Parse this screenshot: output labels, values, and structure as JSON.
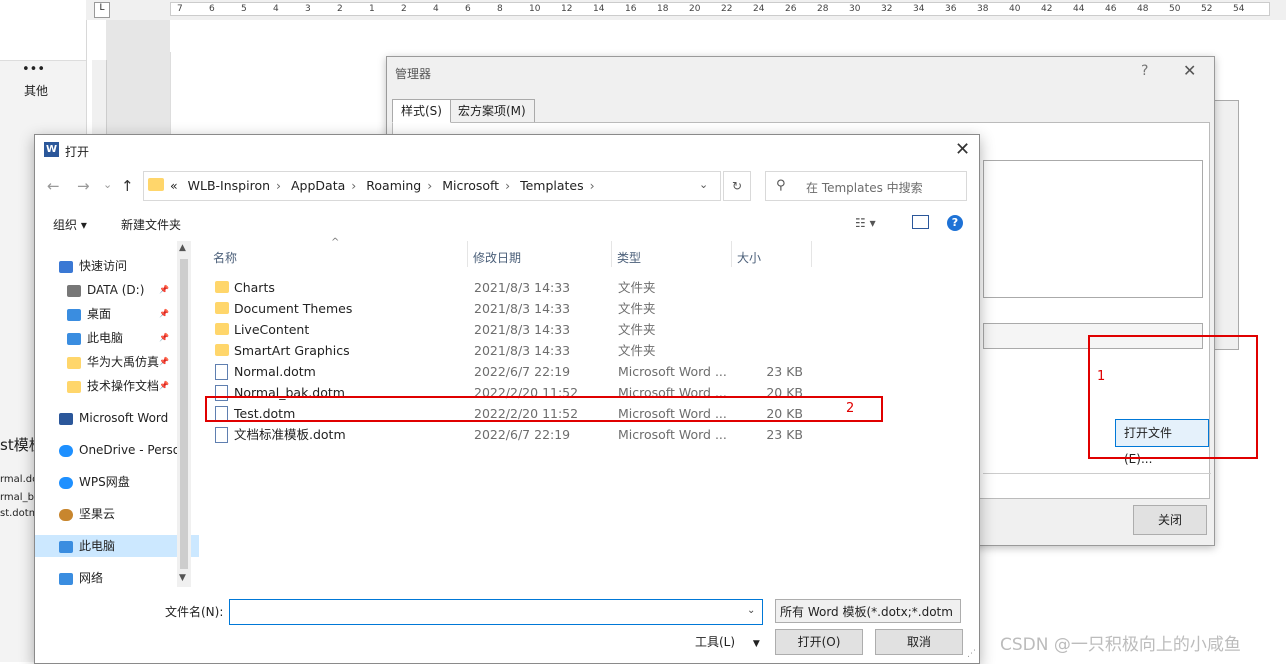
{
  "background": {
    "left_text": [
      "其他",
      "st模板",
      "rmal.do",
      "rmal_b",
      "st.dotm"
    ],
    "ruler_numbers": [
      "7",
      "6",
      "5",
      "4",
      "3",
      "2",
      "1",
      "2",
      "4",
      "6",
      "8",
      "10",
      "12",
      "14",
      "16",
      "18",
      "20",
      "22",
      "24",
      "26",
      "28",
      "30",
      "32",
      "34",
      "36",
      "38",
      "40",
      "42",
      "44",
      "46",
      "48",
      "50",
      "52",
      "54"
    ]
  },
  "manager": {
    "title": "管理器",
    "help": "?",
    "tabs": [
      {
        "label": "样式(S)"
      },
      {
        "label": "宏方案项(M)"
      }
    ],
    "open_file_button": "打开文件(E)...",
    "close_button": "关闭"
  },
  "open_dialog": {
    "title": "打开",
    "address": {
      "prefix": "«",
      "path": [
        "WLB-Inspiron",
        "AppData",
        "Roaming",
        "Microsoft",
        "Templates"
      ]
    },
    "search_placeholder": "在 Templates 中搜索",
    "toolbar": {
      "organize": "组织 ▾",
      "new_folder": "新建文件夹"
    },
    "nav": [
      {
        "label": "快速访问",
        "icon": "star-icon",
        "indent": 1
      },
      {
        "label": "DATA (D:)",
        "icon": "drive-icon",
        "indent": 2
      },
      {
        "label": "桌面",
        "icon": "desktop-icon",
        "indent": 2
      },
      {
        "label": "此电脑",
        "icon": "computer-icon",
        "indent": 2
      },
      {
        "label": "华为大禹仿真",
        "icon": "folder-icon",
        "indent": 2
      },
      {
        "label": "技术操作文档",
        "icon": "folder-icon",
        "indent": 2
      },
      {
        "label": "Microsoft Word",
        "icon": "word-icon",
        "indent": 1
      },
      {
        "label": "OneDrive - Perso",
        "icon": "cloud-icon",
        "indent": 1
      },
      {
        "label": "WPS网盘",
        "icon": "cloud-icon",
        "indent": 1
      },
      {
        "label": "坚果云",
        "icon": "nut-icon",
        "indent": 1
      },
      {
        "label": "此电脑",
        "icon": "computer-icon",
        "indent": 1
      },
      {
        "label": "网络",
        "icon": "network-icon",
        "indent": 1
      }
    ],
    "columns": {
      "name": "名称",
      "date": "修改日期",
      "type": "类型",
      "size": "大小"
    },
    "files": [
      {
        "name": "Charts",
        "date": "2021/8/3 14:33",
        "type": "文件夹",
        "size": "",
        "kind": "folder"
      },
      {
        "name": "Document Themes",
        "date": "2021/8/3 14:33",
        "type": "文件夹",
        "size": "",
        "kind": "folder"
      },
      {
        "name": "LiveContent",
        "date": "2021/8/3 14:33",
        "type": "文件夹",
        "size": "",
        "kind": "folder"
      },
      {
        "name": "SmartArt Graphics",
        "date": "2021/8/3 14:33",
        "type": "文件夹",
        "size": "",
        "kind": "folder"
      },
      {
        "name": "Normal.dotm",
        "date": "2022/6/7 22:19",
        "type": "Microsoft Word ...",
        "size": "23 KB",
        "kind": "doc"
      },
      {
        "name": "Normal_bak.dotm",
        "date": "2022/2/20 11:52",
        "type": "Microsoft Word ...",
        "size": "20 KB",
        "kind": "doc"
      },
      {
        "name": "Test.dotm",
        "date": "2022/2/20 11:52",
        "type": "Microsoft Word ...",
        "size": "20 KB",
        "kind": "doc"
      },
      {
        "name": "文档标准模板.dotm",
        "date": "2022/6/7 22:19",
        "type": "Microsoft Word ...",
        "size": "23 KB",
        "kind": "doc"
      }
    ],
    "filename_label": "文件名(N):",
    "filename_value": "",
    "filetype": "所有 Word 模板(*.dotx;*.dotm",
    "tools": "工具(L)",
    "open_button": "打开(O)",
    "cancel_button": "取消"
  },
  "annotations": {
    "one": "1",
    "two": "2"
  },
  "watermark": "CSDN @一只积极向上的小咸鱼",
  "colors": {
    "accent": "#0078d7",
    "annotation_red": "#e00000",
    "folder": "#ffd66b"
  }
}
